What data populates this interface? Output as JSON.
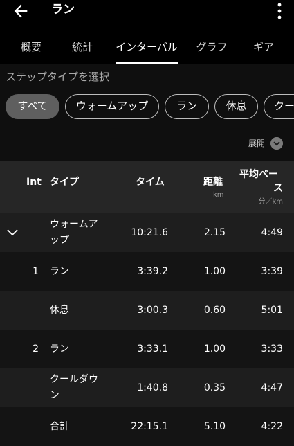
{
  "header": {
    "title": "ラン",
    "back_icon": "arrow-left-icon",
    "menu_icon": "more-vert-icon"
  },
  "tabs": [
    {
      "label": "概要"
    },
    {
      "label": "統計"
    },
    {
      "label": "インターバル",
      "active": true
    },
    {
      "label": "グラフ"
    },
    {
      "label": "ギア"
    }
  ],
  "filter": {
    "label": "ステップタイプを選択",
    "chips": [
      {
        "label": "すべて",
        "selected": true
      },
      {
        "label": "ウォームアップ"
      },
      {
        "label": "ラン"
      },
      {
        "label": "休息"
      },
      {
        "label": "クー"
      }
    ]
  },
  "expand": {
    "label": "展開",
    "icon": "chevron-down-circle-icon"
  },
  "table": {
    "headers": {
      "int": "Int",
      "type": "タイプ",
      "time": "タイム",
      "distance": "距離",
      "distance_unit": "km",
      "pace_line1": "平均ペー",
      "pace_line2": "ス",
      "pace_unit": "分／km"
    },
    "rows": [
      {
        "int": "",
        "type1": "ウォームア",
        "type2": "ップ",
        "time": "10:21.6",
        "distance": "2.15",
        "pace": "4:49",
        "collapsible": true
      },
      {
        "int": "1",
        "type1": "ラン",
        "type2": "",
        "time": "3:39.2",
        "distance": "1.00",
        "pace": "3:39"
      },
      {
        "int": "",
        "type1": "休息",
        "type2": "",
        "time": "3:00.3",
        "distance": "0.60",
        "pace": "5:01"
      },
      {
        "int": "2",
        "type1": "ラン",
        "type2": "",
        "time": "3:33.1",
        "distance": "1.00",
        "pace": "3:33"
      },
      {
        "int": "",
        "type1": "クールダウ",
        "type2": "ン",
        "time": "1:40.8",
        "distance": "0.35",
        "pace": "4:47"
      },
      {
        "int": "",
        "type1": "合計",
        "type2": "",
        "time": "22:15.1",
        "distance": "5.10",
        "pace": "4:22"
      }
    ]
  }
}
